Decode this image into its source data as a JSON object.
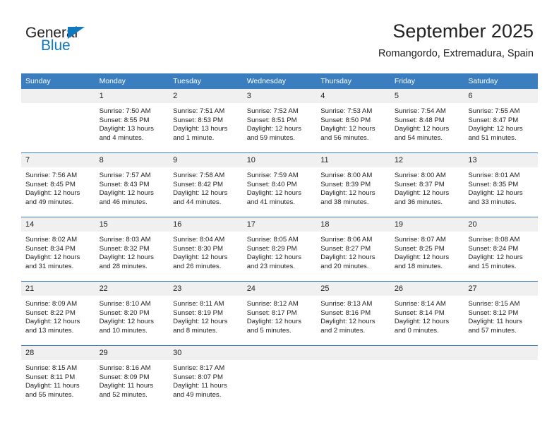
{
  "brand": {
    "name_top": "General",
    "name_bottom": "Blue",
    "accent_color": "#1278be",
    "triangle_icon": "triangle-right-icon"
  },
  "header": {
    "title": "September 2025",
    "subtitle": "Romangordo, Extremadura, Spain"
  },
  "theme": {
    "header_bg": "#3a7ebf",
    "daynum_bg": "#f0f0f0",
    "text": "#222222",
    "page_bg": "#ffffff"
  },
  "weekday_headers": [
    "Sunday",
    "Monday",
    "Tuesday",
    "Wednesday",
    "Thursday",
    "Friday",
    "Saturday"
  ],
  "labels": {
    "sunrise": "Sunrise:",
    "sunset": "Sunset:",
    "daylight": "Daylight:"
  },
  "weeks": [
    [
      {
        "day": "",
        "blank": true,
        "sunrise": "",
        "sunset": "",
        "daylight_a": "",
        "daylight_b": ""
      },
      {
        "day": "1",
        "sunrise": "Sunrise: 7:50 AM",
        "sunset": "Sunset: 8:55 PM",
        "daylight_a": "Daylight: 13 hours",
        "daylight_b": "and 4 minutes."
      },
      {
        "day": "2",
        "sunrise": "Sunrise: 7:51 AM",
        "sunset": "Sunset: 8:53 PM",
        "daylight_a": "Daylight: 13 hours",
        "daylight_b": "and 1 minute."
      },
      {
        "day": "3",
        "sunrise": "Sunrise: 7:52 AM",
        "sunset": "Sunset: 8:51 PM",
        "daylight_a": "Daylight: 12 hours",
        "daylight_b": "and 59 minutes."
      },
      {
        "day": "4",
        "sunrise": "Sunrise: 7:53 AM",
        "sunset": "Sunset: 8:50 PM",
        "daylight_a": "Daylight: 12 hours",
        "daylight_b": "and 56 minutes."
      },
      {
        "day": "5",
        "sunrise": "Sunrise: 7:54 AM",
        "sunset": "Sunset: 8:48 PM",
        "daylight_a": "Daylight: 12 hours",
        "daylight_b": "and 54 minutes."
      },
      {
        "day": "6",
        "sunrise": "Sunrise: 7:55 AM",
        "sunset": "Sunset: 8:47 PM",
        "daylight_a": "Daylight: 12 hours",
        "daylight_b": "and 51 minutes."
      }
    ],
    [
      {
        "day": "7",
        "sunrise": "Sunrise: 7:56 AM",
        "sunset": "Sunset: 8:45 PM",
        "daylight_a": "Daylight: 12 hours",
        "daylight_b": "and 49 minutes."
      },
      {
        "day": "8",
        "sunrise": "Sunrise: 7:57 AM",
        "sunset": "Sunset: 8:43 PM",
        "daylight_a": "Daylight: 12 hours",
        "daylight_b": "and 46 minutes."
      },
      {
        "day": "9",
        "sunrise": "Sunrise: 7:58 AM",
        "sunset": "Sunset: 8:42 PM",
        "daylight_a": "Daylight: 12 hours",
        "daylight_b": "and 44 minutes."
      },
      {
        "day": "10",
        "sunrise": "Sunrise: 7:59 AM",
        "sunset": "Sunset: 8:40 PM",
        "daylight_a": "Daylight: 12 hours",
        "daylight_b": "and 41 minutes."
      },
      {
        "day": "11",
        "sunrise": "Sunrise: 8:00 AM",
        "sunset": "Sunset: 8:39 PM",
        "daylight_a": "Daylight: 12 hours",
        "daylight_b": "and 38 minutes."
      },
      {
        "day": "12",
        "sunrise": "Sunrise: 8:00 AM",
        "sunset": "Sunset: 8:37 PM",
        "daylight_a": "Daylight: 12 hours",
        "daylight_b": "and 36 minutes."
      },
      {
        "day": "13",
        "sunrise": "Sunrise: 8:01 AM",
        "sunset": "Sunset: 8:35 PM",
        "daylight_a": "Daylight: 12 hours",
        "daylight_b": "and 33 minutes."
      }
    ],
    [
      {
        "day": "14",
        "sunrise": "Sunrise: 8:02 AM",
        "sunset": "Sunset: 8:34 PM",
        "daylight_a": "Daylight: 12 hours",
        "daylight_b": "and 31 minutes."
      },
      {
        "day": "15",
        "sunrise": "Sunrise: 8:03 AM",
        "sunset": "Sunset: 8:32 PM",
        "daylight_a": "Daylight: 12 hours",
        "daylight_b": "and 28 minutes."
      },
      {
        "day": "16",
        "sunrise": "Sunrise: 8:04 AM",
        "sunset": "Sunset: 8:30 PM",
        "daylight_a": "Daylight: 12 hours",
        "daylight_b": "and 26 minutes."
      },
      {
        "day": "17",
        "sunrise": "Sunrise: 8:05 AM",
        "sunset": "Sunset: 8:29 PM",
        "daylight_a": "Daylight: 12 hours",
        "daylight_b": "and 23 minutes."
      },
      {
        "day": "18",
        "sunrise": "Sunrise: 8:06 AM",
        "sunset": "Sunset: 8:27 PM",
        "daylight_a": "Daylight: 12 hours",
        "daylight_b": "and 20 minutes."
      },
      {
        "day": "19",
        "sunrise": "Sunrise: 8:07 AM",
        "sunset": "Sunset: 8:25 PM",
        "daylight_a": "Daylight: 12 hours",
        "daylight_b": "and 18 minutes."
      },
      {
        "day": "20",
        "sunrise": "Sunrise: 8:08 AM",
        "sunset": "Sunset: 8:24 PM",
        "daylight_a": "Daylight: 12 hours",
        "daylight_b": "and 15 minutes."
      }
    ],
    [
      {
        "day": "21",
        "sunrise": "Sunrise: 8:09 AM",
        "sunset": "Sunset: 8:22 PM",
        "daylight_a": "Daylight: 12 hours",
        "daylight_b": "and 13 minutes."
      },
      {
        "day": "22",
        "sunrise": "Sunrise: 8:10 AM",
        "sunset": "Sunset: 8:20 PM",
        "daylight_a": "Daylight: 12 hours",
        "daylight_b": "and 10 minutes."
      },
      {
        "day": "23",
        "sunrise": "Sunrise: 8:11 AM",
        "sunset": "Sunset: 8:19 PM",
        "daylight_a": "Daylight: 12 hours",
        "daylight_b": "and 8 minutes."
      },
      {
        "day": "24",
        "sunrise": "Sunrise: 8:12 AM",
        "sunset": "Sunset: 8:17 PM",
        "daylight_a": "Daylight: 12 hours",
        "daylight_b": "and 5 minutes."
      },
      {
        "day": "25",
        "sunrise": "Sunrise: 8:13 AM",
        "sunset": "Sunset: 8:16 PM",
        "daylight_a": "Daylight: 12 hours",
        "daylight_b": "and 2 minutes."
      },
      {
        "day": "26",
        "sunrise": "Sunrise: 8:14 AM",
        "sunset": "Sunset: 8:14 PM",
        "daylight_a": "Daylight: 12 hours",
        "daylight_b": "and 0 minutes."
      },
      {
        "day": "27",
        "sunrise": "Sunrise: 8:15 AM",
        "sunset": "Sunset: 8:12 PM",
        "daylight_a": "Daylight: 11 hours",
        "daylight_b": "and 57 minutes."
      }
    ],
    [
      {
        "day": "28",
        "sunrise": "Sunrise: 8:15 AM",
        "sunset": "Sunset: 8:11 PM",
        "daylight_a": "Daylight: 11 hours",
        "daylight_b": "and 55 minutes."
      },
      {
        "day": "29",
        "sunrise": "Sunrise: 8:16 AM",
        "sunset": "Sunset: 8:09 PM",
        "daylight_a": "Daylight: 11 hours",
        "daylight_b": "and 52 minutes."
      },
      {
        "day": "30",
        "sunrise": "Sunrise: 8:17 AM",
        "sunset": "Sunset: 8:07 PM",
        "daylight_a": "Daylight: 11 hours",
        "daylight_b": "and 49 minutes."
      },
      {
        "day": "",
        "blank": true,
        "sunrise": "",
        "sunset": "",
        "daylight_a": "",
        "daylight_b": ""
      },
      {
        "day": "",
        "blank": true,
        "sunrise": "",
        "sunset": "",
        "daylight_a": "",
        "daylight_b": ""
      },
      {
        "day": "",
        "blank": true,
        "sunrise": "",
        "sunset": "",
        "daylight_a": "",
        "daylight_b": ""
      },
      {
        "day": "",
        "blank": true,
        "sunrise": "",
        "sunset": "",
        "daylight_a": "",
        "daylight_b": ""
      }
    ]
  ]
}
